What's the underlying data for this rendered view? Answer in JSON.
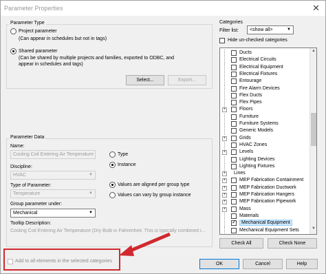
{
  "window": {
    "title": "Parameter Properties"
  },
  "param_type": {
    "group_title": "Parameter Type",
    "project_label": "Project parameter",
    "project_note": "(Can appear in schedules but not in tags)",
    "shared_label": "Shared parameter",
    "shared_note_1": "(Can be shared by multiple projects and families, exported to ODBC, and",
    "shared_note_2": "appear in schedules and tags)",
    "select_button": "Select...",
    "export_button": "Export..."
  },
  "param_data": {
    "group_title": "Parameter Data",
    "name_label": "Name:",
    "name_value": "Cooling Coil Entering Air Temperature",
    "discipline_label": "Discipline:",
    "discipline_value": "HVAC",
    "type_label": "Type of Parameter:",
    "type_value": "Temperature",
    "group_label": "Group parameter under:",
    "group_value": "Mechanical",
    "tooltip_label": "Tooltip Description:",
    "tooltip_value": "Cooling Coil Entering Air Temperature (Dry Bulb in Fahrenheit. This is typically combined i...",
    "type_radio": "Type",
    "instance_radio": "Instance",
    "aligned_radio": "Values are aligned per group type",
    "vary_radio": "Values can vary by group instance"
  },
  "add_all_label": "Add to all elements in the selected categories",
  "categories": {
    "group_title": "Categories",
    "filter_label": "Filter list:",
    "filter_value": "<show all>",
    "hide_unchecked": "Hide un-checked categories",
    "items": [
      {
        "label": "Ducts",
        "expander": false,
        "checked": false
      },
      {
        "label": "Electrical Circuits",
        "expander": false,
        "checked": false
      },
      {
        "label": "Electrical Equipment",
        "expander": false,
        "checked": false
      },
      {
        "label": "Electrical Fixtures",
        "expander": false,
        "checked": false
      },
      {
        "label": "Entourage",
        "expander": false,
        "checked": false
      },
      {
        "label": "Fire Alarm Devices",
        "expander": false,
        "checked": false
      },
      {
        "label": "Flex Ducts",
        "expander": false,
        "checked": false
      },
      {
        "label": "Flex Pipes",
        "expander": false,
        "checked": false
      },
      {
        "label": "Floors",
        "expander": true,
        "checked": false
      },
      {
        "label": "Furniture",
        "expander": false,
        "checked": false
      },
      {
        "label": "Furniture Systems",
        "expander": false,
        "checked": false
      },
      {
        "label": "Generic Models",
        "expander": false,
        "checked": false
      },
      {
        "label": "Grids",
        "expander": true,
        "checked": false
      },
      {
        "label": "HVAC Zones",
        "expander": false,
        "checked": false
      },
      {
        "label": "Levels",
        "expander": true,
        "checked": false
      },
      {
        "label": "Lighting Devices",
        "expander": false,
        "checked": false
      },
      {
        "label": "Lighting Fixtures",
        "expander": false,
        "checked": false
      },
      {
        "label": "Lines",
        "expander": true,
        "checked": null
      },
      {
        "label": "MEP Fabrication Containment",
        "expander": true,
        "checked": false
      },
      {
        "label": "MEP Fabrication Ductwork",
        "expander": true,
        "checked": false
      },
      {
        "label": "MEP Fabrication Hangers",
        "expander": true,
        "checked": false
      },
      {
        "label": "MEP Fabrication Pipework",
        "expander": true,
        "checked": false
      },
      {
        "label": "Mass",
        "expander": true,
        "checked": false
      },
      {
        "label": "Materials",
        "expander": false,
        "checked": false
      },
      {
        "label": "Mechanical Equipment",
        "expander": false,
        "checked": true,
        "highlight": true
      },
      {
        "label": "Mechanical Equipment Sets",
        "expander": false,
        "checked": false
      }
    ],
    "check_all": "Check All",
    "check_none": "Check None"
  },
  "footer": {
    "ok": "OK",
    "cancel": "Cancel",
    "help": "Help"
  },
  "colors": {
    "highlight_box": "#d0282e",
    "selection": "#cce8ff"
  }
}
